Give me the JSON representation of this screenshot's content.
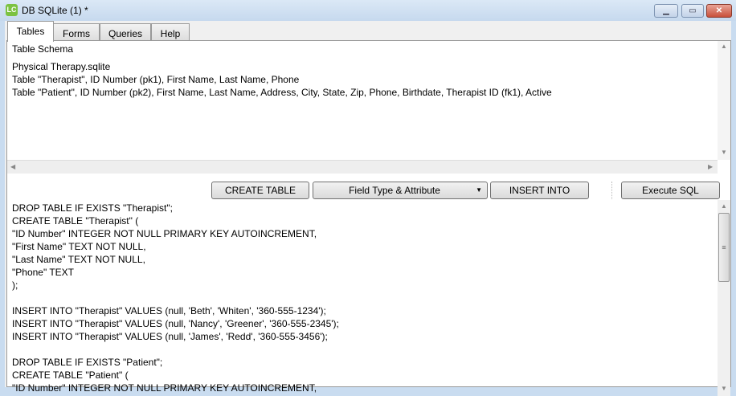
{
  "window": {
    "title": "DB SQLite (1) *",
    "icon": "LC"
  },
  "tabs": [
    {
      "label": "Tables"
    },
    {
      "label": "Forms"
    },
    {
      "label": "Queries"
    },
    {
      "label": "Help"
    }
  ],
  "schema": {
    "heading": "Table Schema",
    "lines": [
      "Physical Therapy.sqlite",
      "Table \"Therapist\", ID Number (pk1), First Name, Last Name, Phone",
      "Table \"Patient\", ID Number (pk2), First Name, Last Name, Address, City, State, Zip, Phone, Birthdate, Therapist ID (fk1), Active"
    ]
  },
  "toolbar": {
    "create_table": "CREATE TABLE",
    "field_type": "Field Type & Attribute",
    "insert_into": "INSERT INTO",
    "execute": "Execute SQL"
  },
  "sql": "DROP TABLE IF EXISTS \"Therapist\";\nCREATE TABLE \"Therapist\" (\n\"ID Number\" INTEGER NOT NULL PRIMARY KEY AUTOINCREMENT,\n\"First Name\" TEXT NOT NULL,\n\"Last Name\" TEXT NOT NULL,\n\"Phone\" TEXT\n);\n\nINSERT INTO \"Therapist\" VALUES (null, 'Beth', 'Whiten', '360-555-1234');\nINSERT INTO \"Therapist\" VALUES (null, 'Nancy', 'Greener', '360-555-2345');\nINSERT INTO \"Therapist\" VALUES (null, 'James', 'Redd', '360-555-3456');\n\nDROP TABLE IF EXISTS \"Patient\";\nCREATE TABLE \"Patient\" (\n\"ID Number\" INTEGER NOT NULL PRIMARY KEY AUTOINCREMENT,"
}
